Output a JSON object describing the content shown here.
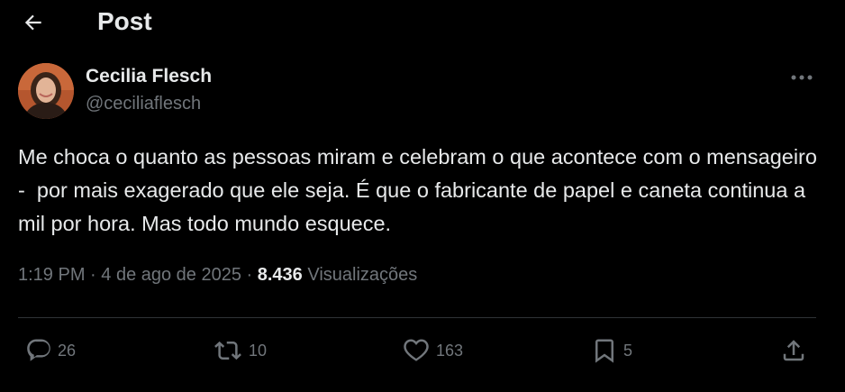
{
  "header": {
    "title": "Post",
    "back_icon": "arrow-left-icon"
  },
  "author": {
    "name": "Cecilia Flesch",
    "handle": "@ceciliaflesch"
  },
  "tweet": {
    "text": "Me choca o quanto as pessoas miram e celebram o que acontece com o mensageiro -  por mais exagerado que ele seja. É que o fabricante de papel e caneta continua a mil por hora. Mas todo mundo esquece.",
    "time": "1:19 PM",
    "date": "4 de ago de 2025",
    "views_count": "8.436",
    "views_label": "Visualizações"
  },
  "actions": {
    "replies": "26",
    "reposts": "10",
    "likes": "163",
    "bookmarks": "5"
  },
  "colors": {
    "background": "#000000",
    "text_primary": "#e7e9ea",
    "text_secondary": "#71767b",
    "divider": "#2f3336"
  },
  "icons": [
    "arrow-left-icon",
    "more-dots-icon",
    "reply-icon",
    "repost-icon",
    "like-icon",
    "bookmark-icon",
    "share-icon"
  ]
}
